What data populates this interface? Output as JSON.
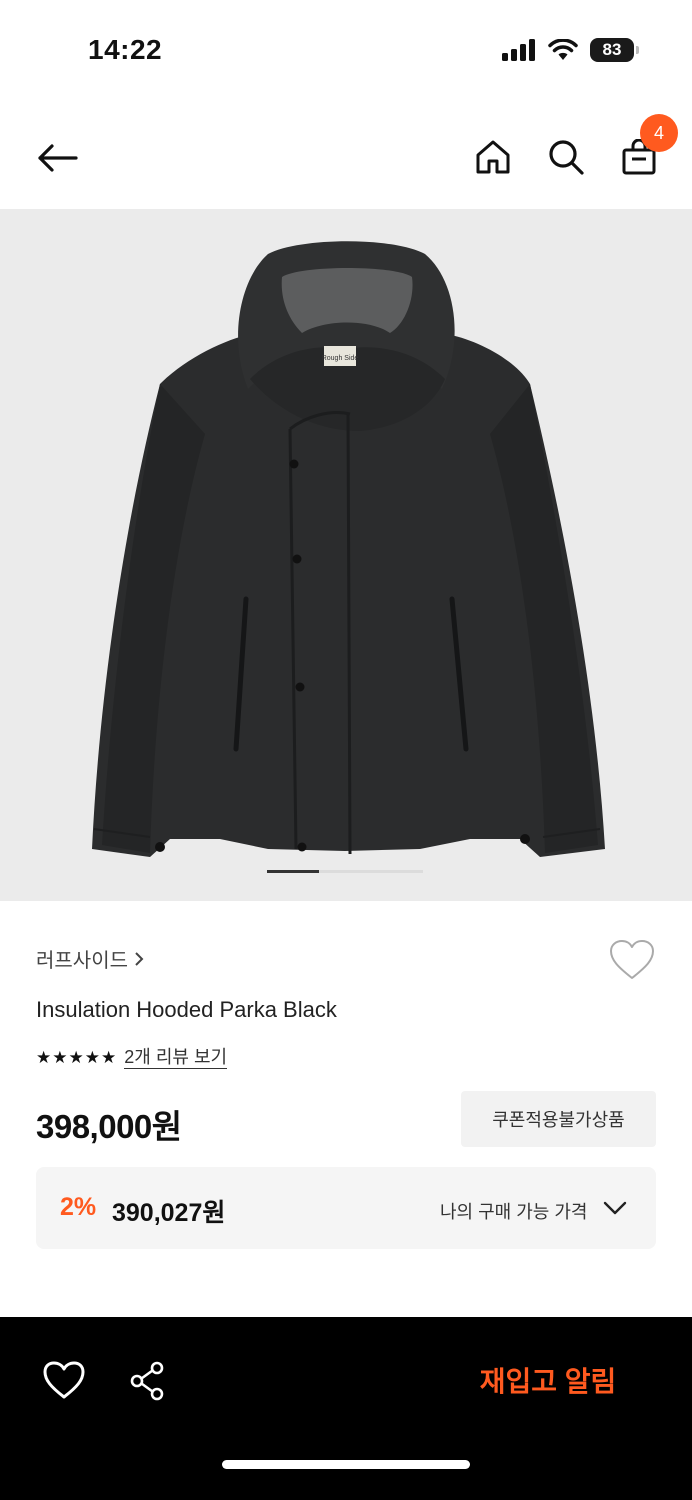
{
  "status_bar": {
    "time": "14:22",
    "battery": "83"
  },
  "header": {
    "cart_count": "4"
  },
  "product": {
    "brand": "러프사이드",
    "name": "Insulation Hooded Parka Black",
    "rating_stars": 5,
    "review_link": "2개 리뷰 보기",
    "price": "398,000원",
    "coupon_badge": "쿠폰적용불가상품",
    "discount": {
      "rate": "2%",
      "price": "390,027원",
      "label": "나의 구매 가능 가격"
    },
    "image_label": "Rough Side",
    "image_page": {
      "current": 1,
      "total": 3
    }
  },
  "bottom_bar": {
    "restock_button": "재입고 알림"
  },
  "colors": {
    "accent": "#ff5a1f",
    "jacket": "#2b2c2d",
    "image_bg": "#ebebeb"
  },
  "icons": [
    "back-arrow-icon",
    "home-icon",
    "search-icon",
    "shopping-bag-icon",
    "heart-icon",
    "chevron-down-icon",
    "share-icon",
    "chevron-right-icon"
  ]
}
